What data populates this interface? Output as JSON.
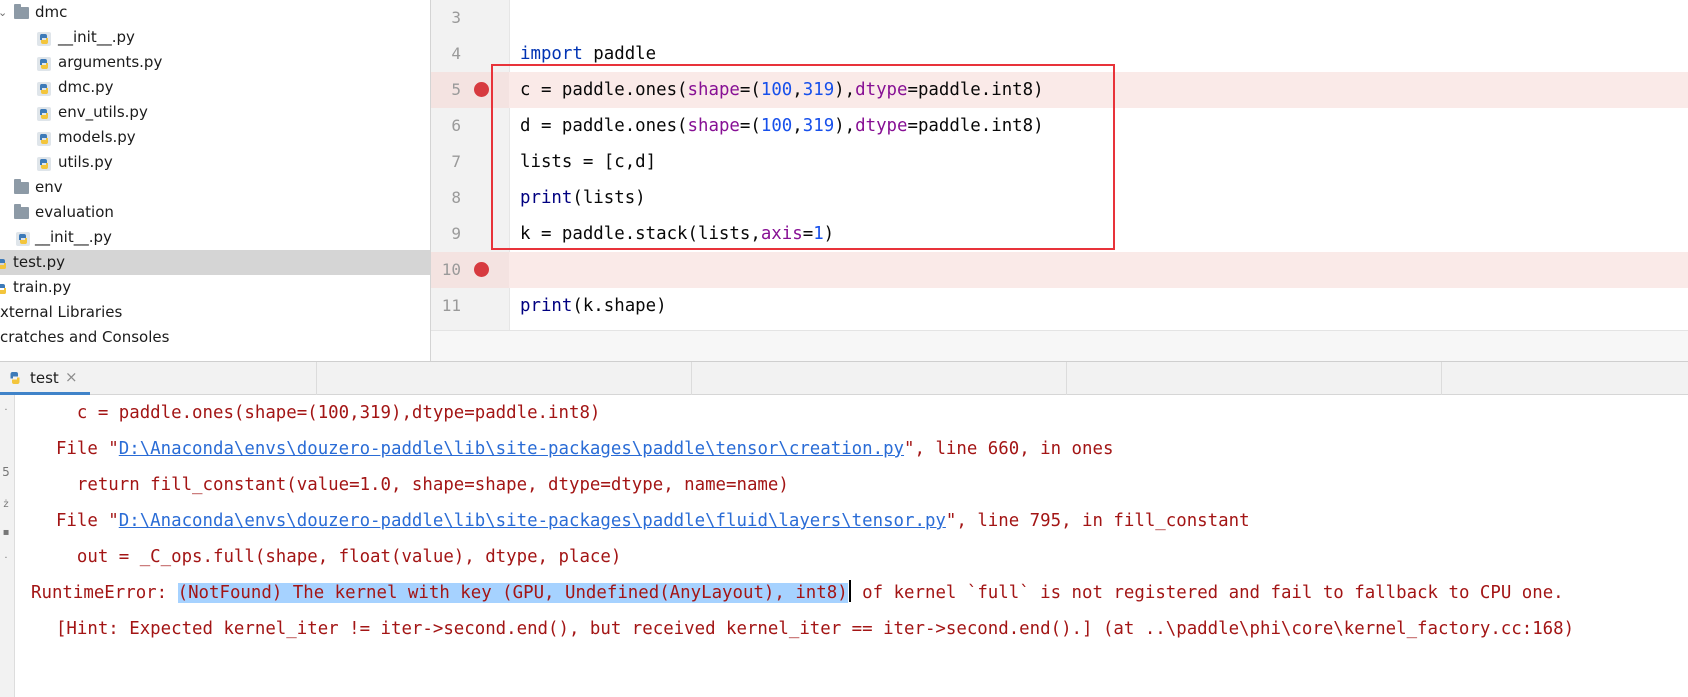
{
  "project_tree": {
    "items": [
      {
        "label": "dmc",
        "type": "folder"
      },
      {
        "label": "__init__.py",
        "type": "py"
      },
      {
        "label": "arguments.py",
        "type": "py"
      },
      {
        "label": "dmc.py",
        "type": "py"
      },
      {
        "label": "env_utils.py",
        "type": "py"
      },
      {
        "label": "models.py",
        "type": "py"
      },
      {
        "label": "utils.py",
        "type": "py"
      },
      {
        "label": "env",
        "type": "folder"
      },
      {
        "label": "evaluation",
        "type": "folder"
      },
      {
        "label": "__init__.py",
        "type": "py"
      },
      {
        "label": "test.py",
        "type": "py",
        "selected": true
      },
      {
        "label": "train.py",
        "type": "py"
      },
      {
        "label": "xternal Libraries",
        "type": "text"
      },
      {
        "label": "cratches and Consoles",
        "type": "text"
      }
    ]
  },
  "editor": {
    "lines": [
      {
        "number": "3"
      },
      {
        "number": "4",
        "tokens": {
          "kw": "import",
          "rest": " paddle"
        }
      },
      {
        "number": "5",
        "breakpoint": true,
        "tokens": {
          "a": "c = paddle.ones(",
          "p1": "shape",
          "b": "=(",
          "n1": "100",
          "c": ",",
          "n2": "319",
          "d": "),",
          "p2": "dtype",
          "e": "=paddle.int8)"
        }
      },
      {
        "number": "6",
        "tokens": {
          "a": "d = paddle.ones(",
          "p1": "shape",
          "b": "=(",
          "n1": "100",
          "c": ",",
          "n2": "319",
          "d": "),",
          "p2": "dtype",
          "e": "=paddle.int8)"
        }
      },
      {
        "number": "7",
        "tokens": {
          "text": "lists = [c,d]"
        }
      },
      {
        "number": "8",
        "tokens": {
          "fn": "print",
          "rest": "(lists)"
        }
      },
      {
        "number": "9",
        "tokens": {
          "a": "k = paddle.stack(lists,",
          "p1": "axis",
          "b": "=",
          "n1": "1",
          "c": ")"
        }
      },
      {
        "number": "10",
        "breakpoint": true
      },
      {
        "number": "11",
        "tokens": {
          "fn": "print",
          "rest": "(k.shape)"
        }
      }
    ]
  },
  "run_panel": {
    "tab_label": "test",
    "console_lines": [
      {
        "text": "    c = paddle.ones(shape=(100,319),dtype=paddle.int8)"
      },
      {
        "pre": "  File \"",
        "link": "D:\\Anaconda\\envs\\douzero-paddle\\lib\\site-packages\\paddle\\tensor\\creation.py",
        "post": "\", line 660, in ones"
      },
      {
        "text": "    return fill_constant(value=1.0, shape=shape, dtype=dtype, name=name)"
      },
      {
        "pre": "  File \"",
        "link": "D:\\Anaconda\\envs\\douzero-paddle\\lib\\site-packages\\paddle\\fluid\\layers\\tensor.py",
        "post": "\", line 795, in fill_constant"
      },
      {
        "text": "    out = _C_ops.full(shape, float(value), dtype, place)"
      },
      {
        "pre": "RuntimeError: ",
        "highlight": "(NotFound) The kernel with key (GPU, Undefined(AnyLayout), int8)",
        "post": " of kernel `full` is not registered and fail to fallback to CPU one."
      },
      {
        "text": "  [Hint: Expected kernel_iter != iter->second.end(), but received kernel_iter == iter->second.end().] (at ..\\paddle\\phi\\core\\kernel_factory.cc:168)"
      }
    ]
  },
  "colors": {
    "keyword": "#0033b3",
    "param": "#871094",
    "number": "#1750eb",
    "error_text": "#a31515",
    "link": "#2a6cd6",
    "breakpoint": "#d73a3f",
    "highlight_box": "#e8333a",
    "selection": "#a6d2ff"
  }
}
